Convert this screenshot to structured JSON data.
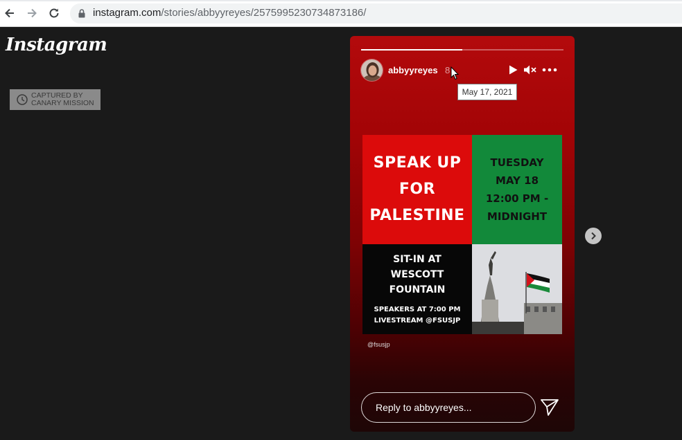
{
  "browser": {
    "url_host": "instagram.com",
    "url_path": "/stories/abbyyreyes/2575995230734873186/"
  },
  "page": {
    "logo": "Instagram",
    "capture_badge": {
      "line1": "CAPTURED BY",
      "line2": "CANARY MISSION"
    }
  },
  "story": {
    "username": "abbyyreyes",
    "time_short": "8",
    "tooltip_date": "May 17, 2021",
    "progress": 0.5,
    "poster": {
      "headline": [
        "SPEAK UP",
        "FOR",
        "PALESTINE"
      ],
      "date_block": [
        "TUESDAY",
        "MAY 18",
        "12:00 PM -",
        "MIDNIGHT"
      ],
      "event": [
        "SIT-IN AT",
        "WESCOTT FOUNTAIN"
      ],
      "details": [
        "SPEAKERS AT 7:00 PM",
        "LIVESTREAM @FSUSJP"
      ]
    },
    "handle": "@fsusjp",
    "reply_placeholder": "Reply to abbyyreyes..."
  },
  "colors": {
    "poster_red": "#dc0b0b",
    "poster_green": "#12893a",
    "story_bg_top": "#b30a0c"
  },
  "icons": [
    "back-icon",
    "forward-icon",
    "reload-icon",
    "lock-icon",
    "clock-icon",
    "play-icon",
    "mute-icon",
    "more-icon",
    "send-icon",
    "chevron-right-icon"
  ]
}
